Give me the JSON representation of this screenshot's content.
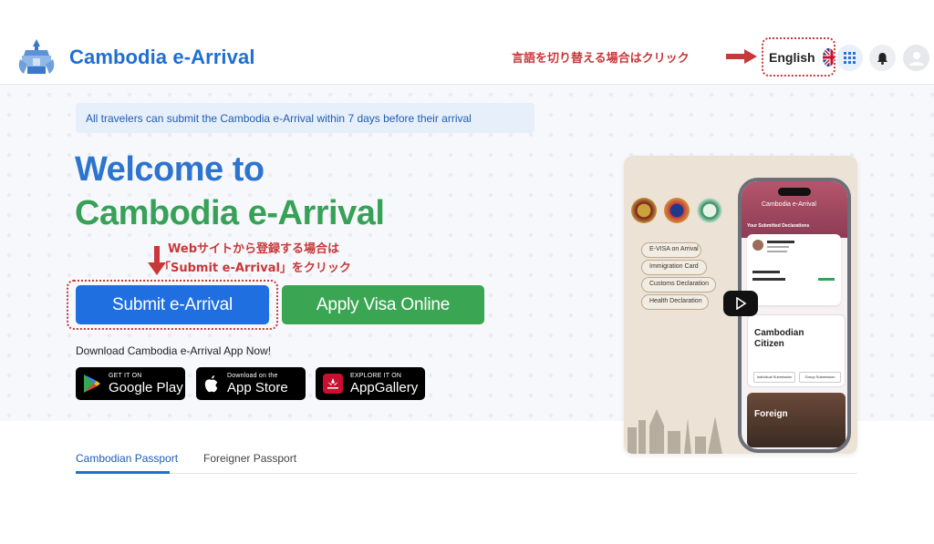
{
  "header": {
    "brand": "Cambodia e-Arrival",
    "language_annotation": "言語を切り替える場合はクリック",
    "language_label": "English",
    "language_flag_icon": "uk-flag-icon",
    "apps_icon": "grid-icon",
    "notification_icon": "bell-icon",
    "account_icon": "user-avatar-icon"
  },
  "hero": {
    "notice": "All travelers can submit the Cambodia e-Arrival within 7 days before their arrival",
    "welcome_line1": "Welcome to",
    "welcome_line2": "Cambodia e-Arrival",
    "submit_annotation_line1": "Webサイトから登録する場合は",
    "submit_annotation_line2": "「Submit e-Arrival」をクリック",
    "submit_button": "Submit e-Arrival",
    "visa_button": "Apply Visa Online",
    "download_text": "Download Cambodia e-Arrival App Now!",
    "stores": {
      "google_small": "GET IT ON",
      "google_big": "Google Play",
      "apple_small": "Download on the",
      "apple_big": "App Store",
      "huawei_small": "EXPLORE IT ON",
      "huawei_big": "AppGallery"
    }
  },
  "promo": {
    "menu": [
      "E-VISA on Arrival",
      "Immigration Card",
      "Customs Declaration",
      "Health Declaration"
    ],
    "app_title": "Cambodia e-Arrival",
    "declarations_title": "Your Submitted Declarations",
    "citizen_title_1": "Cambodian",
    "citizen_title_2": "Citizen",
    "individual": "Individual Submission",
    "group": "Group Submission",
    "foreign_title": "Foreign"
  },
  "tabs": [
    "Cambodian Passport",
    "Foreigner Passport"
  ],
  "colors": {
    "primary_blue": "#1f6fe0",
    "primary_green": "#3aa653",
    "annotation_red": "#c8383a",
    "brand_blue": "#1f6fd1"
  }
}
